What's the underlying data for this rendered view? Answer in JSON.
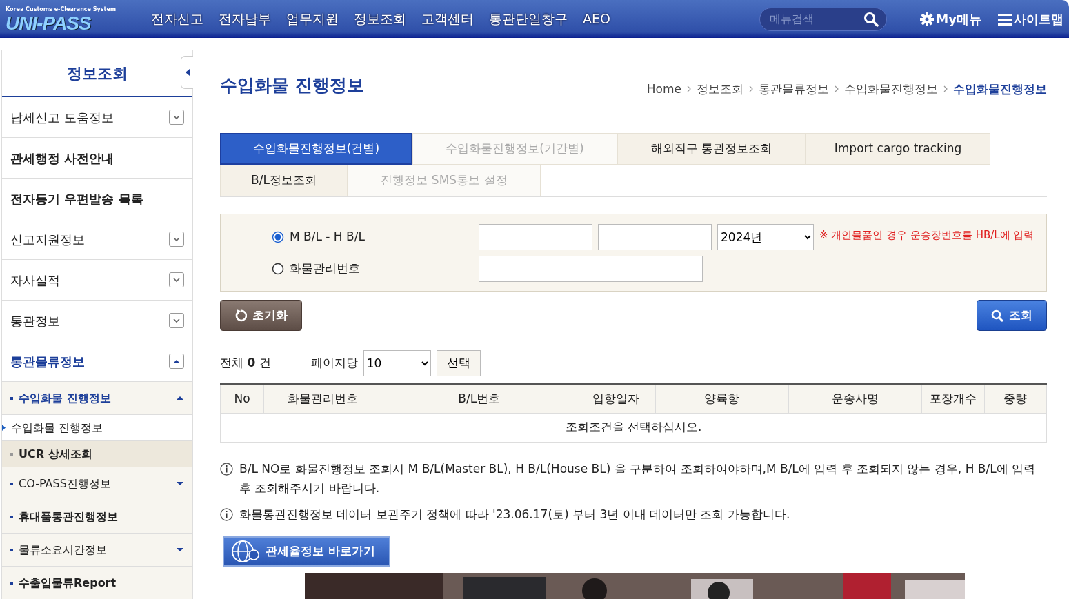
{
  "header": {
    "logo_caption": "Korea Customs e-Clearance System",
    "logo": "UNI-PASS",
    "menu": [
      "전자신고",
      "전자납부",
      "업무지원",
      "정보조회",
      "고객센터",
      "통관단일창구",
      "AEO"
    ],
    "search": {
      "placeholder": "메뉴검색"
    },
    "my_menu": "My메뉴",
    "sitemap": "사이트맵"
  },
  "sidebar": {
    "title": "정보조회",
    "items": [
      {
        "kind": "group",
        "label": "납세신고 도움정보",
        "expanded": false
      },
      {
        "kind": "link",
        "label": "관세행정 사전안내"
      },
      {
        "kind": "link",
        "label": "전자등기 우편발송 목록"
      },
      {
        "kind": "group",
        "label": "신고지원정보",
        "expanded": false
      },
      {
        "kind": "group",
        "label": "자사실적",
        "expanded": false
      },
      {
        "kind": "group",
        "label": "통관정보",
        "expanded": false
      },
      {
        "kind": "group",
        "label": "통관물류정보",
        "expanded": true,
        "children": [
          {
            "kind": "group",
            "label": "수입화물 진행정보",
            "expanded": true,
            "children": [
              {
                "label": "수입화물 진행정보",
                "selected": true
              },
              {
                "label": "UCR 상세조회",
                "selected": false
              }
            ]
          },
          {
            "kind": "group",
            "label": "CO-PASS진행정보",
            "expanded": false
          },
          {
            "kind": "link",
            "label": "휴대품통관진행정보"
          },
          {
            "kind": "group",
            "label": "물류소요시간정보",
            "expanded": false
          },
          {
            "kind": "link",
            "label": "수출입물류Report"
          }
        ]
      }
    ]
  },
  "page": {
    "title": "수입화물 진행정보",
    "breadcrumb": [
      "Home",
      "정보조회",
      "통관물류정보",
      "수입화물진행정보",
      "수입화물진행정보"
    ]
  },
  "tabs": [
    [
      {
        "label": "수입화물진행정보(건별)",
        "selected": true,
        "disabled": false
      },
      {
        "label": "수입화물진행정보(기간별)",
        "selected": false,
        "disabled": true
      },
      {
        "label": "해외직구 통관정보조회",
        "selected": false,
        "disabled": false
      },
      {
        "label": "Import cargo tracking",
        "selected": false,
        "disabled": false
      }
    ],
    [
      {
        "label": "B/L정보조회",
        "selected": false,
        "disabled": false
      },
      {
        "label": "진행정보 SMS통보 설정",
        "selected": false,
        "disabled": true
      }
    ]
  ],
  "search_form": {
    "options": [
      {
        "label": "M B/L - H B/L",
        "selected": true
      },
      {
        "label": "화물관리번호",
        "selected": false
      }
    ],
    "year": "2024년",
    "notice": "※ 개인물품인 경우 운송장번호를 HB/L에 입력",
    "reset_button": "초기화",
    "search_button": "조회"
  },
  "results": {
    "total_label": "전체",
    "total": "0",
    "total_unit": "건",
    "per_page_label": "페이지당",
    "per_page": "10",
    "apply_button": "선택",
    "columns": [
      "No",
      "화물관리번호",
      "B/L번호",
      "입항일자",
      "양륙항",
      "운송사명",
      "포장개수",
      "중량"
    ],
    "empty_message": "조회조건을 선택하십시오."
  },
  "notes": [
    "B/L NO로 화물진행정보 조회시 M B/L(Master BL), H B/L(House BL) 을 구분하여 조회하여야하며,M B/L에 입력 후 조회되지 않는 경우, H B/L에 입력 후 조회해주시기 바랍니다.",
    "화물통관진행정보 데이터 보관주기 정책에 따라 '23.06.17(토) 부터 3년 이내 데이터만 조회 가능합니다."
  ],
  "tariff_link": "관세율정보 바로가기",
  "banner": {
    "kind": "picture"
  }
}
